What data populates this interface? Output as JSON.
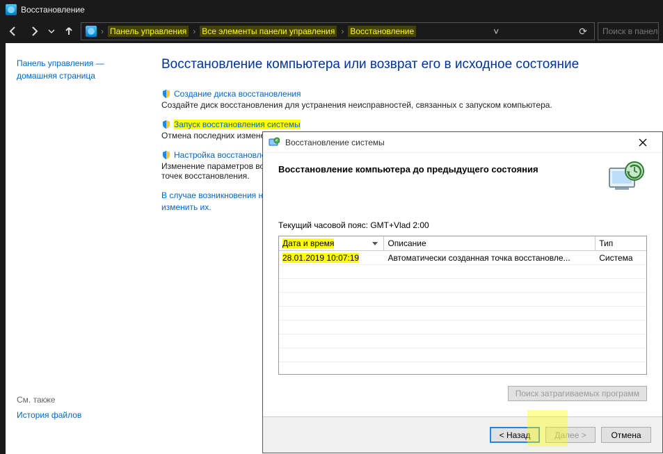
{
  "window": {
    "title": "Восстановление"
  },
  "toolbar": {
    "search_placeholder": "Поиск в панели"
  },
  "breadcrumb": {
    "items": [
      "Панель управления",
      "Все элементы панели управления",
      "Восстановление"
    ]
  },
  "sidebar": {
    "heading": "Панель управления — домашняя страница",
    "see_also": "См. также",
    "history": "История файлов"
  },
  "main": {
    "h1": "Восстановление компьютера или возврат его в исходное состояние",
    "items": [
      {
        "link": "Создание диска восстановления",
        "desc": "Создайте диск восстановления для устранения неисправностей, связанных с запуском компьютера."
      },
      {
        "link": "Запуск восстановления системы",
        "desc": "Отмена последних изменений, музыка, остаются без изме"
      },
      {
        "link": "Настройка восстановле",
        "desc": "Изменение параметров во\nточек восстановления."
      }
    ],
    "problems_prefix": "В случае возникновения н",
    "problems_link": "изменить их."
  },
  "dialog": {
    "title": "Восстановление системы",
    "heading": "Восстановление компьютера до предыдущего состояния",
    "timezone": "Текущий часовой пояс: GMT+Vlad 2:00",
    "columns": {
      "date": "Дата и время",
      "desc": "Описание",
      "type": "Тип"
    },
    "rows": [
      {
        "date": "28.01.2019 10:07:19",
        "desc": "Автоматически созданная точка восстановле...",
        "type": "Система"
      }
    ],
    "search_affected": "Поиск затрагиваемых программ",
    "buttons": {
      "back": "< Назад",
      "next": "Далее >",
      "cancel": "Отмена"
    }
  }
}
